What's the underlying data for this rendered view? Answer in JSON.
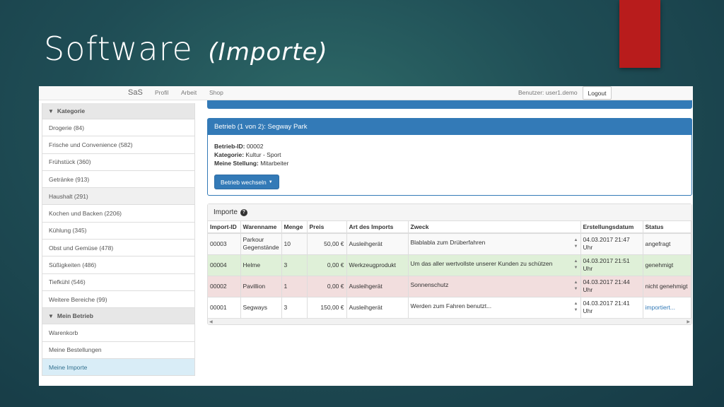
{
  "slide": {
    "title": "Software",
    "subtitle": "(Importe)"
  },
  "navbar": {
    "brand": "SaS",
    "links": [
      "Profil",
      "Arbeit",
      "Shop"
    ],
    "user": "Benutzer: user1.demo",
    "logout": "Logout"
  },
  "sidebar": {
    "kategorie_header": "Kategorie",
    "categories": [
      "Drogerie (84)",
      "Frische und Convenience (582)",
      "Frühstück (360)",
      "Getränke (913)",
      "Haushalt (291)",
      "Kochen und Backen (2206)",
      "Kühlung (345)",
      "Obst und Gemüse (478)",
      "Süßigkeiten (486)",
      "Tiefkühl (546)",
      "Weitere Bereiche (99)"
    ],
    "betrieb_header": "Mein Betrieb",
    "betrieb_items": [
      "Warenkorb",
      "Meine Bestellungen",
      "Meine Importe"
    ]
  },
  "betrieb_panel": {
    "title": "Betrieb (1 von 2): Segway Park",
    "id_label": "Betrieb-ID:",
    "id_value": "00002",
    "kat_label": "Kategorie:",
    "kat_value": "Kultur - Sport",
    "stellung_label": "Meine Stellung:",
    "stellung_value": "Mitarbeiter",
    "button": "Betrieb wechseln"
  },
  "importe": {
    "title": "Importe",
    "columns": [
      "Import-ID",
      "Warenname",
      "Menge",
      "Preis",
      "Art des Imports",
      "Zweck",
      "Erstellungsdatum",
      "Status"
    ],
    "rows": [
      {
        "id": "00003",
        "name": "Parkour Gegenstände",
        "menge": "10",
        "preis": "50,00 €",
        "art": "Ausleihgerät",
        "zweck": "Blablabla zum Drüberfahren",
        "datum1": "04.03.2017 21:47",
        "datum2": "Uhr",
        "status": "angefragt"
      },
      {
        "id": "00004",
        "name": "Helme",
        "menge": "3",
        "preis": "0,00 €",
        "art": "Werkzeugprodukt",
        "zweck": "Um das aller wertvollste unserer Kunden zu schützen",
        "datum1": "04.03.2017 21:51",
        "datum2": "Uhr",
        "status": "genehmigt"
      },
      {
        "id": "00002",
        "name": "Pavillion",
        "menge": "1",
        "preis": "0,00 €",
        "art": "Ausleihgerät",
        "zweck": "Sonnenschutz",
        "datum1": "04.03.2017 21:44",
        "datum2": "Uhr",
        "status": "nicht genehmigt"
      },
      {
        "id": "00001",
        "name": "Segways",
        "menge": "3",
        "preis": "150,00 €",
        "art": "Ausleihgerät",
        "zweck": "Werden zum Fahren benutzt...",
        "datum1": "04.03.2017 21:41",
        "datum2": "Uhr",
        "status": "importiert..."
      }
    ]
  },
  "colors": {
    "primary": "#337ab7",
    "success": "#dff0d8",
    "danger": "#f2dede",
    "accent_red": "#b81c1c"
  },
  "icons": {
    "chevron": "chevron-down-icon",
    "help": "question-circle-icon",
    "caret": "caret-down-icon"
  }
}
